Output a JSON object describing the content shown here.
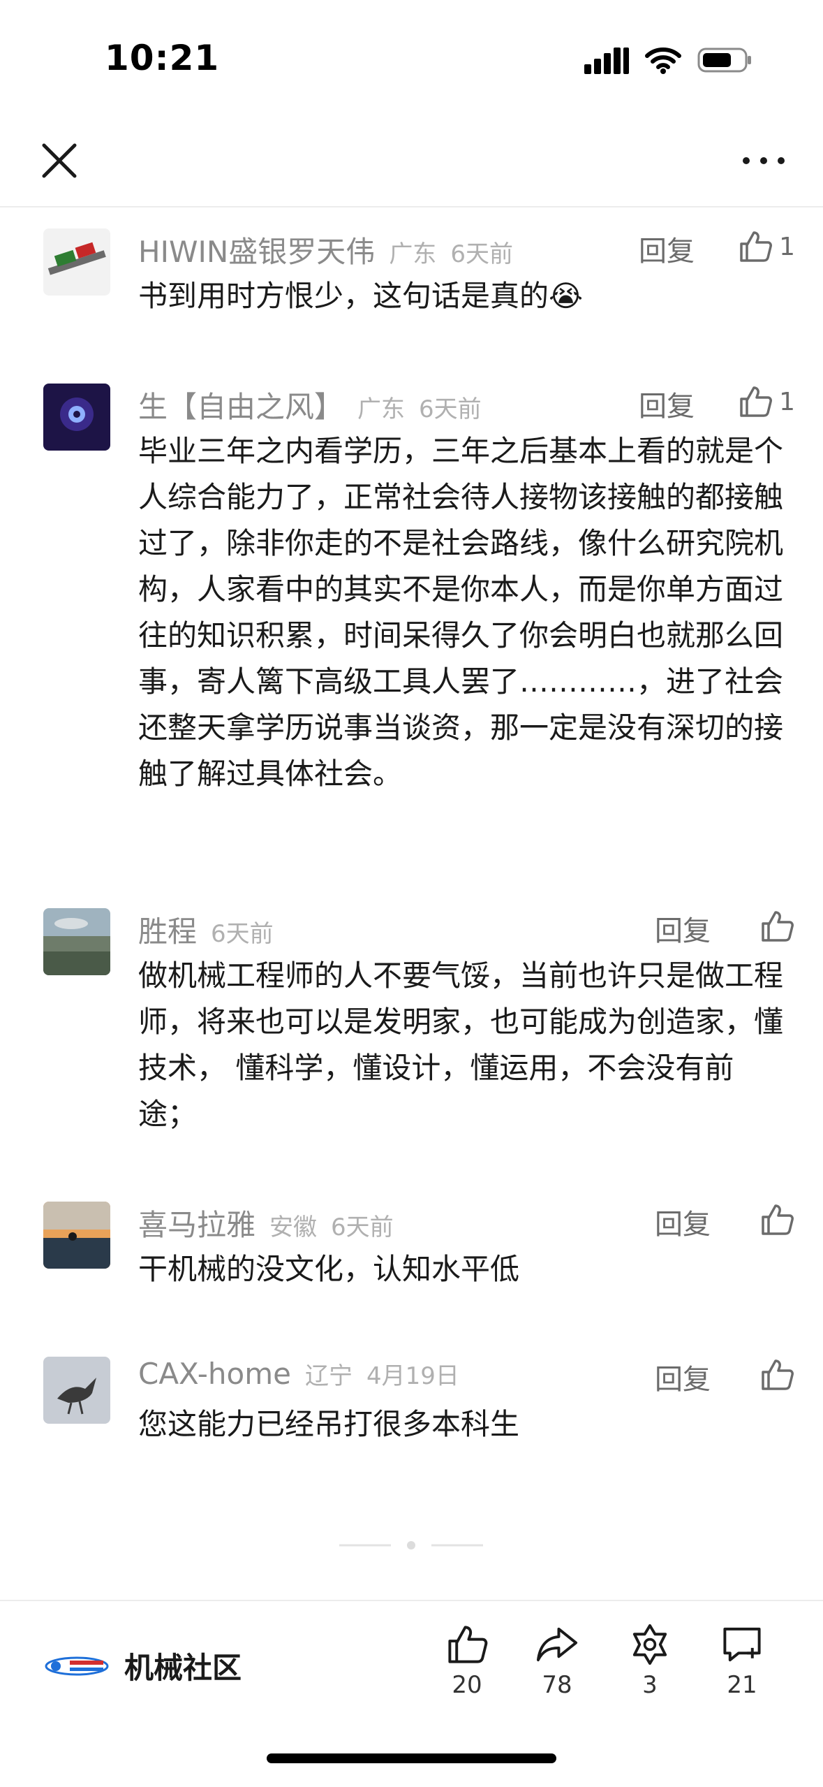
{
  "status_bar": {
    "time": "10:21"
  },
  "nav": {
    "close_icon": "close-icon",
    "more_icon": "more-icon"
  },
  "comments": [
    {
      "name": "HIWIN盛银罗天伟",
      "location": "广东",
      "time": "6天前",
      "reply": "回复",
      "likes": "1",
      "text": "书到用时方恨少，这句话是真的😭"
    },
    {
      "name": "生【自由之风】",
      "location": "广东",
      "time": "6天前",
      "reply": "回复",
      "likes": "1",
      "text": "毕业三年之内看学历，三年之后基本上看的就是个人综合能力了，正常社会待人接物该接触的都接触过了，除非你走的不是社会路线，像什么研究院机构，人家看中的其实不是你本人，而是你单方面过往的知识积累，时间呆得久了你会明白也就那么回事，寄人篱下高级工具人罢了…………，进了社会还整天拿学历说事当谈资，那一定是没有深切的接触了解过具体社会。"
    },
    {
      "name": "胜程",
      "location": "",
      "time": "6天前",
      "reply": "回复",
      "likes": "",
      "text": "做机械工程师的人不要气馁，当前也许只是做工程师，将来也可以是发明家，也可能成为创造家，懂技术， 懂科学，懂设计，懂运用，不会没有前途；"
    },
    {
      "name": "喜马拉雅",
      "location": "安徽",
      "time": "6天前",
      "reply": "回复",
      "likes": "",
      "text": "干机械的没文化，认知水平低"
    },
    {
      "name": "CAX-home",
      "location": "辽宁",
      "time": "4月19日",
      "reply": "回复",
      "likes": "",
      "text": "您这能力已经吊打很多本科生"
    }
  ],
  "bottom_bar": {
    "community_name": "机械社区",
    "actions": [
      {
        "icon": "thumbs-up-icon",
        "count": "20"
      },
      {
        "icon": "share-icon",
        "count": "78"
      },
      {
        "icon": "collect-icon",
        "count": "3"
      },
      {
        "icon": "comment-add-icon",
        "count": "21"
      }
    ]
  }
}
